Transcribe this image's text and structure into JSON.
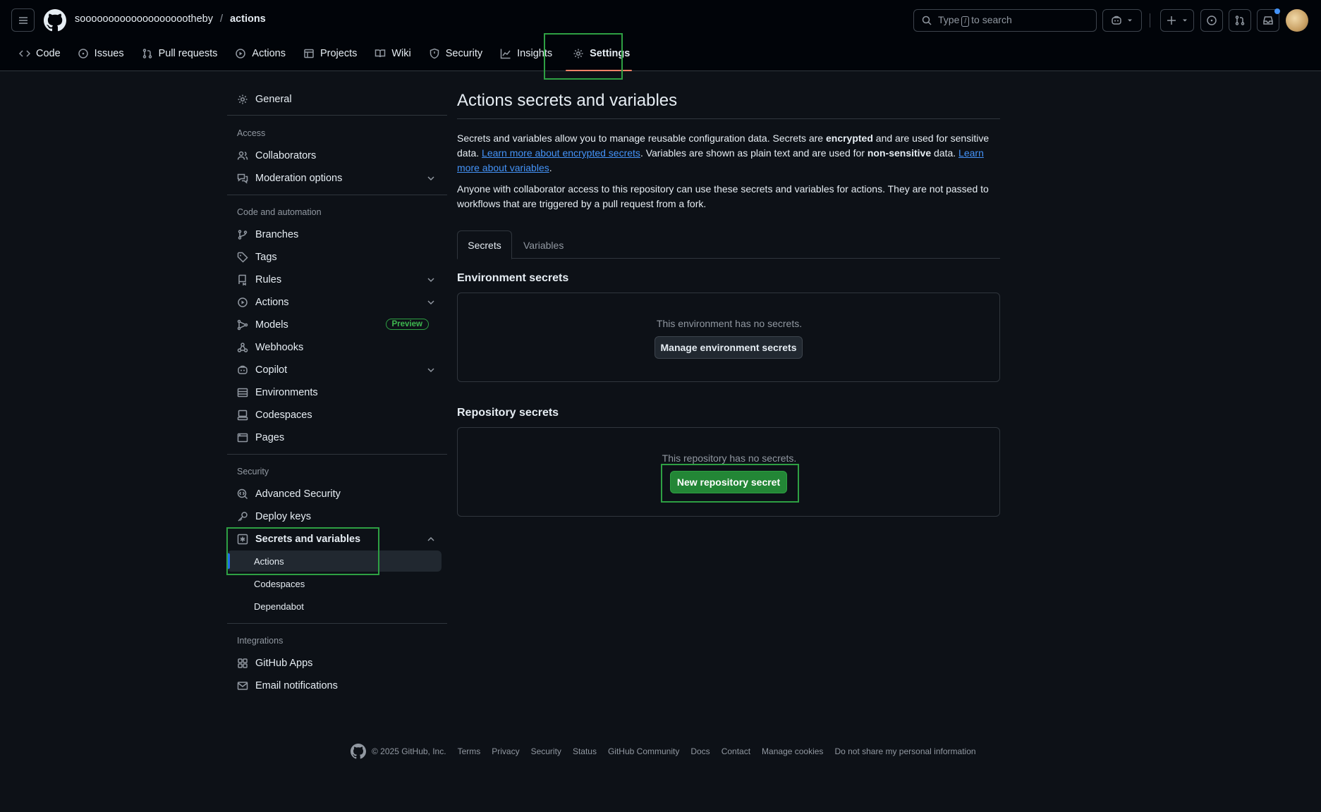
{
  "header": {
    "owner": "soooooooooooooooooootheby",
    "separator": "/",
    "repo": "actions",
    "search_prefix": "Type",
    "search_key": "/",
    "search_suffix": "to search"
  },
  "repo_nav": {
    "tabs": [
      {
        "label": "Code",
        "icon": "code-icon"
      },
      {
        "label": "Issues",
        "icon": "issue-opened-icon"
      },
      {
        "label": "Pull requests",
        "icon": "git-pull-request-icon"
      },
      {
        "label": "Actions",
        "icon": "play-icon"
      },
      {
        "label": "Projects",
        "icon": "table-icon"
      },
      {
        "label": "Wiki",
        "icon": "book-icon"
      },
      {
        "label": "Security",
        "icon": "shield-icon"
      },
      {
        "label": "Insights",
        "icon": "graph-icon"
      },
      {
        "label": "Settings",
        "icon": "gear-icon",
        "active": true
      }
    ]
  },
  "sidebar": {
    "general": "General",
    "groups": {
      "access": "Access",
      "code_automation": "Code and automation",
      "security": "Security",
      "integrations": "Integrations"
    },
    "items": {
      "collaborators": "Collaborators",
      "moderation": "Moderation options",
      "branches": "Branches",
      "tags": "Tags",
      "rules": "Rules",
      "actions": "Actions",
      "models": "Models",
      "models_badge": "Preview",
      "webhooks": "Webhooks",
      "copilot": "Copilot",
      "environments": "Environments",
      "codespaces": "Codespaces",
      "pages": "Pages",
      "advanced_security": "Advanced Security",
      "deploy_keys": "Deploy keys",
      "secrets_variables": "Secrets and variables",
      "sub_actions": "Actions",
      "sub_codespaces": "Codespaces",
      "sub_dependabot": "Dependabot",
      "github_apps": "GitHub Apps",
      "email_notifications": "Email notifications"
    }
  },
  "main": {
    "title": "Actions secrets and variables",
    "p1": {
      "t1": "Secrets and variables allow you to manage reusable configuration data. Secrets are ",
      "b1": "encrypted",
      "t2": " and are used for sensitive data. ",
      "link1": "Learn more about encrypted secrets",
      "t3": ". Variables are shown as plain text and are used for ",
      "b2": "non-sensitive",
      "t4": " data. ",
      "link2": "Learn more about variables",
      "t5": "."
    },
    "p2": "Anyone with collaborator access to this repository can use these secrets and variables for actions. They are not passed to workflows that are triggered by a pull request from a fork.",
    "tabs": {
      "secrets": "Secrets",
      "variables": "Variables"
    },
    "env_title": "Environment secrets",
    "env_empty": "This environment has no secrets.",
    "env_button": "Manage environment secrets",
    "repo_title": "Repository secrets",
    "repo_empty": "This repository has no secrets.",
    "repo_button": "New repository secret"
  },
  "footer": {
    "copyright": "© 2025 GitHub, Inc.",
    "links": [
      "Terms",
      "Privacy",
      "Security",
      "Status",
      "GitHub Community",
      "Docs",
      "Contact",
      "Manage cookies",
      "Do not share my personal information"
    ]
  },
  "colors": {
    "accent_green": "#238636",
    "highlight_green": "#2ea043",
    "active_tab_underline": "#f78166",
    "link_blue": "#4493f8"
  }
}
